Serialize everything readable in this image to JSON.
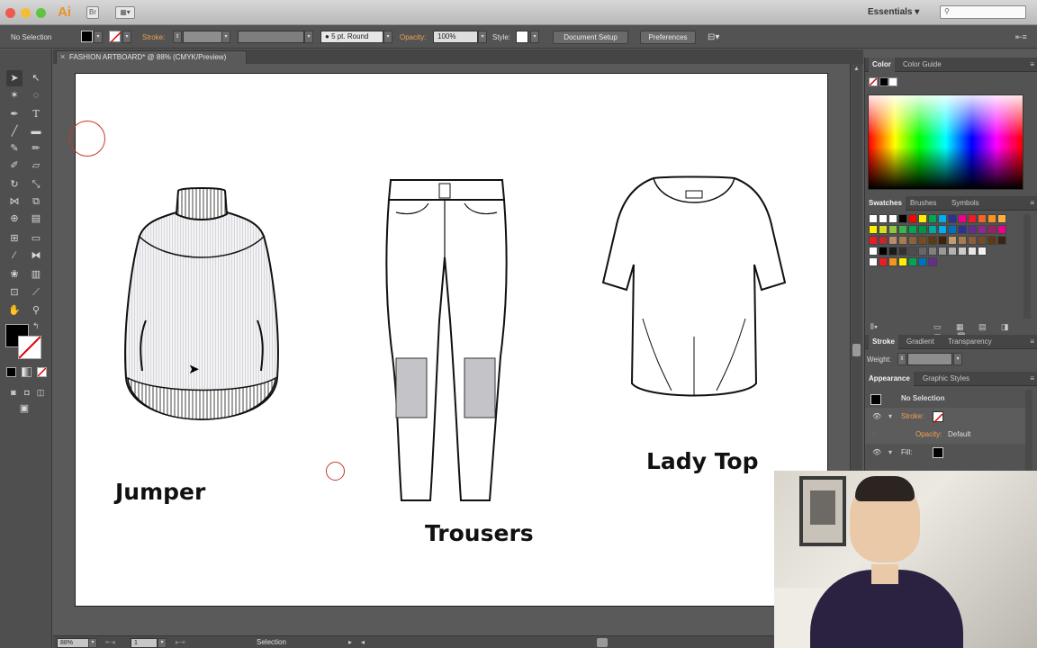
{
  "app": {
    "logo": "Ai",
    "bridge_label": "Br",
    "workspace": "Essentials"
  },
  "controlbar": {
    "selection_status": "No Selection",
    "stroke_label": "Stroke:",
    "brush_value": "5 pt. Round",
    "opacity_label": "Opacity:",
    "opacity_value": "100%",
    "style_label": "Style:",
    "document_setup": "Document Setup",
    "preferences": "Preferences"
  },
  "document": {
    "tab_title": "FASHION ARTBOARD* @ 88% (CMYK/Preview)"
  },
  "artboard": {
    "labels": {
      "jumper": "Jumper",
      "trousers": "Trousers",
      "lady_top": "Lady Top"
    }
  },
  "statusbar": {
    "zoom": "88%",
    "artboard_number": "1",
    "tool_status": "Selection"
  },
  "panels": {
    "color_tabs": [
      "Color",
      "Color Guide"
    ],
    "swatches_tabs": [
      "Swatches",
      "Brushes",
      "Symbols"
    ],
    "stroke_tabs": [
      "Stroke",
      "Gradient",
      "Transparency"
    ],
    "stroke_weight_label": "Weight:",
    "appearance_tabs": [
      "Appearance",
      "Graphic Styles"
    ],
    "appearance": {
      "title": "No Selection",
      "stroke_label": "Stroke:",
      "opacity_label": "Opacity:",
      "opacity_value": "Default",
      "fill_label": "Fill:"
    }
  },
  "colors": {
    "accent_orange": "#e89428",
    "marker_red": "#c0392b",
    "panel_bg": "#535353"
  }
}
